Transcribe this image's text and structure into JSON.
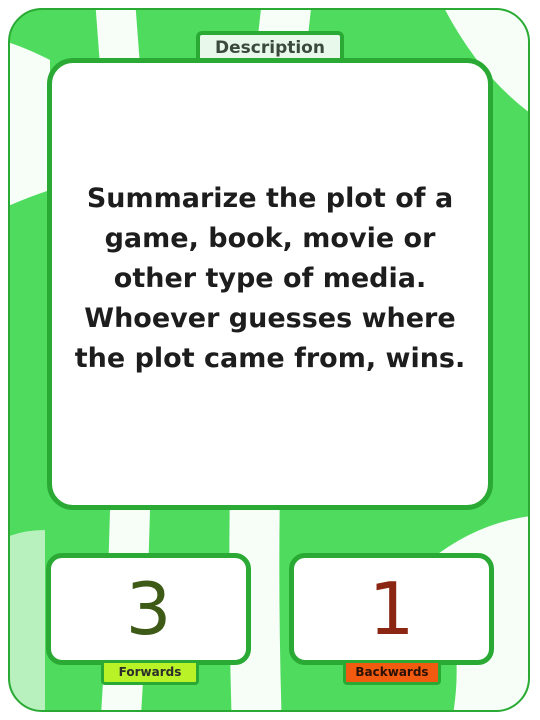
{
  "card": {
    "tab_label": "Description",
    "description": "Summarize the plot of a game, book, movie or other type of media. Whoever guesses where the plot came from, wins.",
    "forwards": {
      "value": "3",
      "label": "Forwards"
    },
    "backwards": {
      "value": "1",
      "label": "Backwards"
    }
  },
  "colors": {
    "card_green": "#4fdc5e",
    "border_green": "#2aaa35",
    "forwards_label": "#b9f227",
    "backwards_label": "#f25a0f",
    "forwards_number": "#3d5a17",
    "backwards_number": "#8a2612"
  }
}
